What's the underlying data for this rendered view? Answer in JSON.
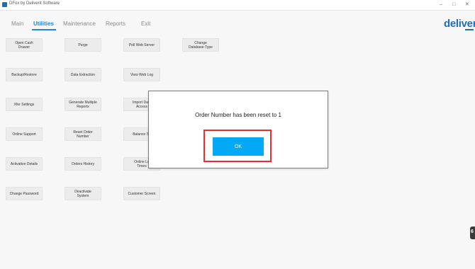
{
  "window": {
    "title": "DFox by Deliverit Software",
    "controls": {
      "minimize": "–",
      "maximize": "□",
      "close": "✕"
    }
  },
  "menu": {
    "tabs": [
      "Main",
      "Utilities",
      "Maintenance",
      "Reports",
      "Exit"
    ],
    "active": "Utilities"
  },
  "brand": {
    "name": "deliverit"
  },
  "tiles": [
    "Open Cash\nDrawer",
    "Purge",
    "Poll Web Server",
    "Change\nDatabase-Type",
    "Backup/Restore",
    "Data Extraction",
    "View Web Log",
    "Xfer Settings",
    "Generate Multiple\nReports",
    "Import Data\nAccess",
    "Online Support",
    "Reset Order\nNumber",
    "Balance Sh",
    "Activation Details",
    "Orders History",
    "Online Lo\nTimes",
    "Change Password",
    "Deactivate\nSystem",
    "Customer Screen"
  ],
  "dialog": {
    "message": "Order Number has been reset to 1",
    "ok_label": "OK"
  },
  "side_handle": {
    "glyph": "6"
  },
  "colors": {
    "accent": "#1e88d6",
    "ok_button": "#03a9f4",
    "highlight": "#e0312f",
    "brand": "#1b6fb8"
  }
}
